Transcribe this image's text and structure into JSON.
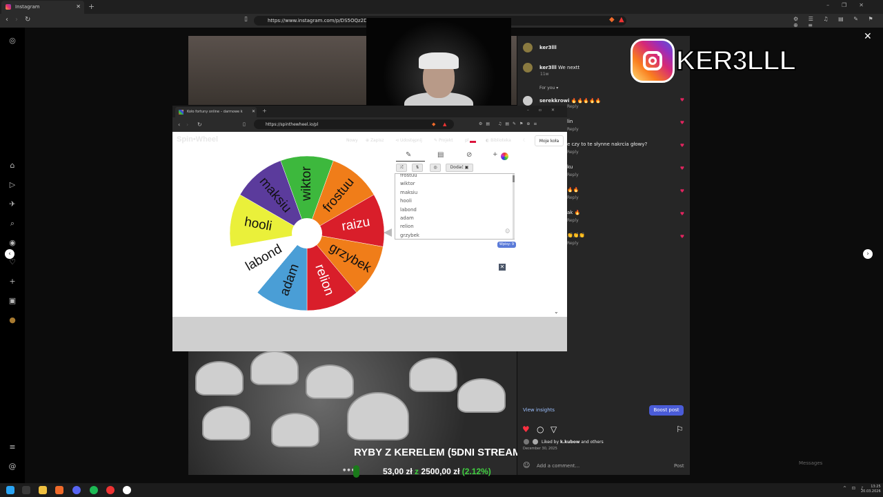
{
  "outer_browser": {
    "tab_title": "Instagram",
    "url": "https://www.instagram.com/p/DS5OQz2DKFS/",
    "window_controls": [
      "–",
      "❐",
      "✕"
    ]
  },
  "logo": {
    "text": "KER3LLL"
  },
  "post": {
    "overlay_title": "RYBY Z KERELEM (5DNI STREAM)",
    "amount_current": "53,00 zł",
    "amount_sep": "z",
    "amount_goal": "2500,00 zł",
    "amount_pct": "(2.12%)"
  },
  "comments": {
    "author": "ker3lll",
    "caption_user": "ker3lll",
    "caption_text": "We nextt",
    "caption_age": "11w",
    "for_you": "For you",
    "items": [
      {
        "user": "serekkrowi",
        "text": "🔥🔥🔥🔥🔥",
        "reply": "Reply"
      },
      {
        "user": "",
        "text": "lin",
        "reply": "Reply"
      },
      {
        "user": "",
        "text": "e czy to te słynne nakrcia głowy?",
        "reply": "Reply"
      },
      {
        "user": "",
        "text": "ku",
        "reply": "Reply"
      },
      {
        "user": "",
        "text": "🔥🔥",
        "reply": "Reply"
      },
      {
        "user": "",
        "text": "ak 🔥",
        "reply": "Reply"
      },
      {
        "user": "",
        "text": "👏👏👏",
        "reply": "Reply"
      }
    ],
    "view_insights": "View insights",
    "boost_post": "Boost post",
    "liked_by_prefix": "Liked by",
    "liked_by_user": "k.kubow",
    "liked_by_suffix": "and others",
    "date": "December 30, 2025",
    "add_comment_placeholder": "Add a comment...",
    "post_button": "Post",
    "messages": "Messages"
  },
  "inner_browser": {
    "tab_title": "Koło fortuny online – darmowe k",
    "url": "https://spinthewheel.io/pl"
  },
  "spinwheel": {
    "logo": "Spin•Wheel",
    "nav": [
      "Nowy",
      "Zapisz",
      "Udostępnij",
      "Projekt",
      "pl",
      "Biblioteka"
    ],
    "moje_kola": "Moje koła",
    "add_button": "Dodać",
    "entries": [
      "frostuu",
      "wiktor",
      "maksiu",
      "hooli",
      "labond",
      "adam",
      "relion",
      "grzybek"
    ],
    "entries_count": "Wpisy: 9",
    "segments": [
      {
        "label": "wiktor",
        "color": "#3db83d"
      },
      {
        "label": "frostuu",
        "color": "#f07d19"
      },
      {
        "label": "raizu",
        "color": "#d91e2a"
      },
      {
        "label": "grzybek",
        "color": "#f07d19"
      },
      {
        "label": "relion",
        "color": "#d91e2a"
      },
      {
        "label": "adam",
        "color": "#4a9ed6"
      },
      {
        "label": "labond",
        "color": "#ffffff"
      },
      {
        "label": "hooli",
        "color": "#eaf03a"
      },
      {
        "label": "maksiu",
        "color": "#5b3b9c"
      }
    ]
  },
  "taskbar": {
    "time": "13:25",
    "date": "20.03.2026"
  }
}
